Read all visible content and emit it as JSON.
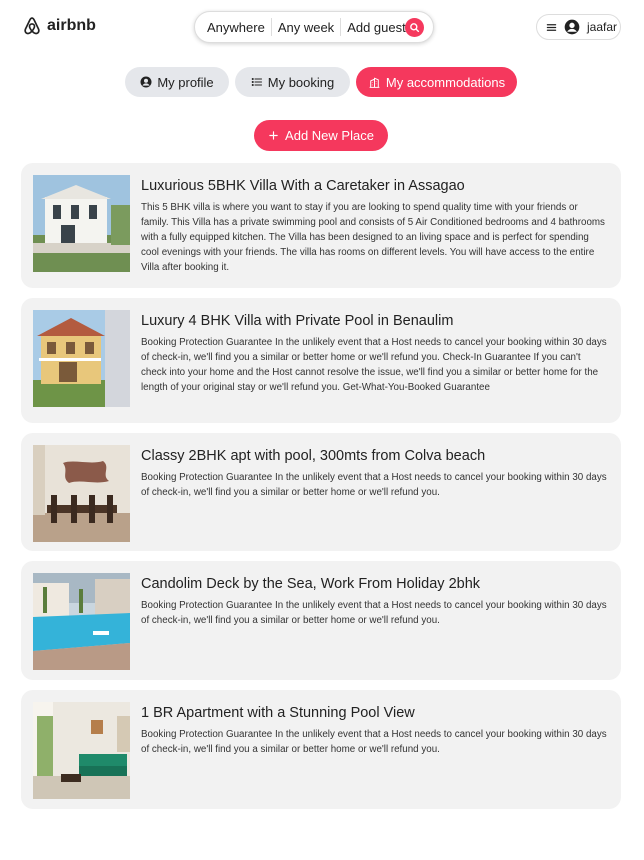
{
  "brand": {
    "name": "airbnb",
    "color": "#f5385d"
  },
  "search": {
    "anywhere": "Anywhere",
    "week": "Any week",
    "guests": "Add guests",
    "icon": "search-icon"
  },
  "user": {
    "name": "jaafar",
    "menu_icon": "hamburger-icon",
    "avatar_icon": "user-circle-icon"
  },
  "tabs": [
    {
      "label": "My profile",
      "icon": "user-icon",
      "active": false
    },
    {
      "label": "My booking",
      "icon": "list-icon",
      "active": false
    },
    {
      "label": "My accommodations",
      "icon": "building-icon",
      "active": true
    }
  ],
  "add_button": {
    "label": "Add New Place",
    "icon": "plus-icon"
  },
  "places": [
    {
      "title": "Luxurious 5BHK Villa With a Caretaker in Assagao",
      "description": "This 5 BHK villa is where you want to stay if you are looking to spend quality time with your friends or family. This Villa has a private swimming pool and consists of 5 Air Conditioned bedrooms and 4 bathrooms with a fully equipped kitchen. The Villa has been designed to an living space and is perfect for spending cool evenings with your friends. The villa has rooms on different levels. You will have access to the entire Villa after booking it."
    },
    {
      "title": "Luxury 4 BHK Villa with Private Pool in Benaulim",
      "description": "Booking Protection Guarantee In the unlikely event that a Host needs to cancel your booking within 30 days of check-in, we'll find you a similar or better home or we'll refund you. Check-In Guarantee If you can't check into your home and the Host cannot resolve the issue, we'll find you a similar or better home for the length of your original stay or we'll refund you. Get-What-You-Booked Guarantee"
    },
    {
      "title": "Classy 2BHK apt with pool, 300mts from Colva beach",
      "description": "Booking Protection Guarantee In the unlikely event that a Host needs to cancel your booking within 30 days of check-in, we'll find you a similar or better home or we'll refund you."
    },
    {
      "title": "Candolim Deck by the Sea, Work From Holiday 2bhk",
      "description": "Booking Protection Guarantee In the unlikely event that a Host needs to cancel your booking within 30 days of check-in, we'll find you a similar or better home or we'll refund you."
    },
    {
      "title": "1 BR Apartment with a Stunning Pool View",
      "description": "Booking Protection Guarantee In the unlikely event that a Host needs to cancel your booking within 30 days of check-in, we'll find you a similar or better home or we'll refund you."
    }
  ]
}
